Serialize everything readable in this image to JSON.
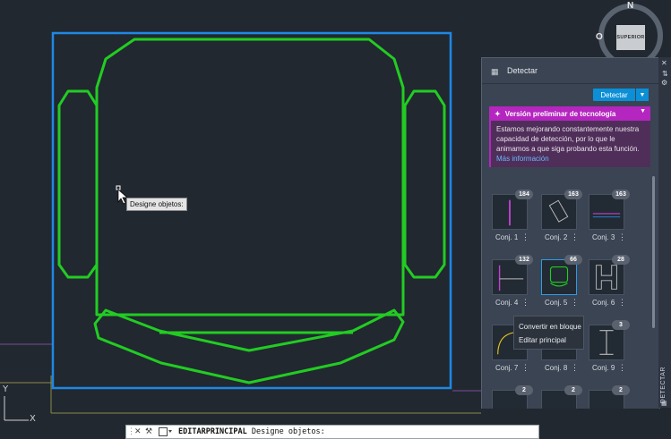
{
  "tooltip": {
    "text": "Designe objetos:"
  },
  "viewcube": {
    "north": "N",
    "west": "O",
    "face": "SUPERIOR"
  },
  "ucs": {
    "x": "X",
    "y": "Y"
  },
  "panel": {
    "title": "Detectar",
    "detect_button": "Detectar",
    "preview": {
      "title": "Versión preliminar de tecnología",
      "body": "Estamos mejorando constantemente nuestra capacidad de detección, por lo que le animamos a que siga probando esta función.",
      "link": "Más información"
    },
    "sets": [
      {
        "label": "Conj. 1",
        "count": "184"
      },
      {
        "label": "Conj. 2",
        "count": "163"
      },
      {
        "label": "Conj. 3",
        "count": "163"
      },
      {
        "label": "Conj. 4",
        "count": "132"
      },
      {
        "label": "Conj. 5",
        "count": "66"
      },
      {
        "label": "Conj. 6",
        "count": "28"
      },
      {
        "label": "Conj. 7",
        "count": ""
      },
      {
        "label": "Conj. 8",
        "count": ""
      },
      {
        "label": "Conj. 9",
        "count": "3"
      },
      {
        "label": "",
        "count": "2"
      },
      {
        "label": "",
        "count": "2"
      },
      {
        "label": "",
        "count": "2"
      }
    ],
    "context_menu": {
      "convert": "Convertir en bloque",
      "edit": "Editar principal"
    },
    "side_tab": "DETECTAR"
  },
  "command_line": {
    "command": "EDITARPRINCIPAL",
    "prompt": "Designe objetos:"
  },
  "colors": {
    "background": "#212830",
    "selection": "#1e88e5",
    "geometry": "#22cc22",
    "accent": "#0b8fd7",
    "preview": "#b525c0"
  }
}
